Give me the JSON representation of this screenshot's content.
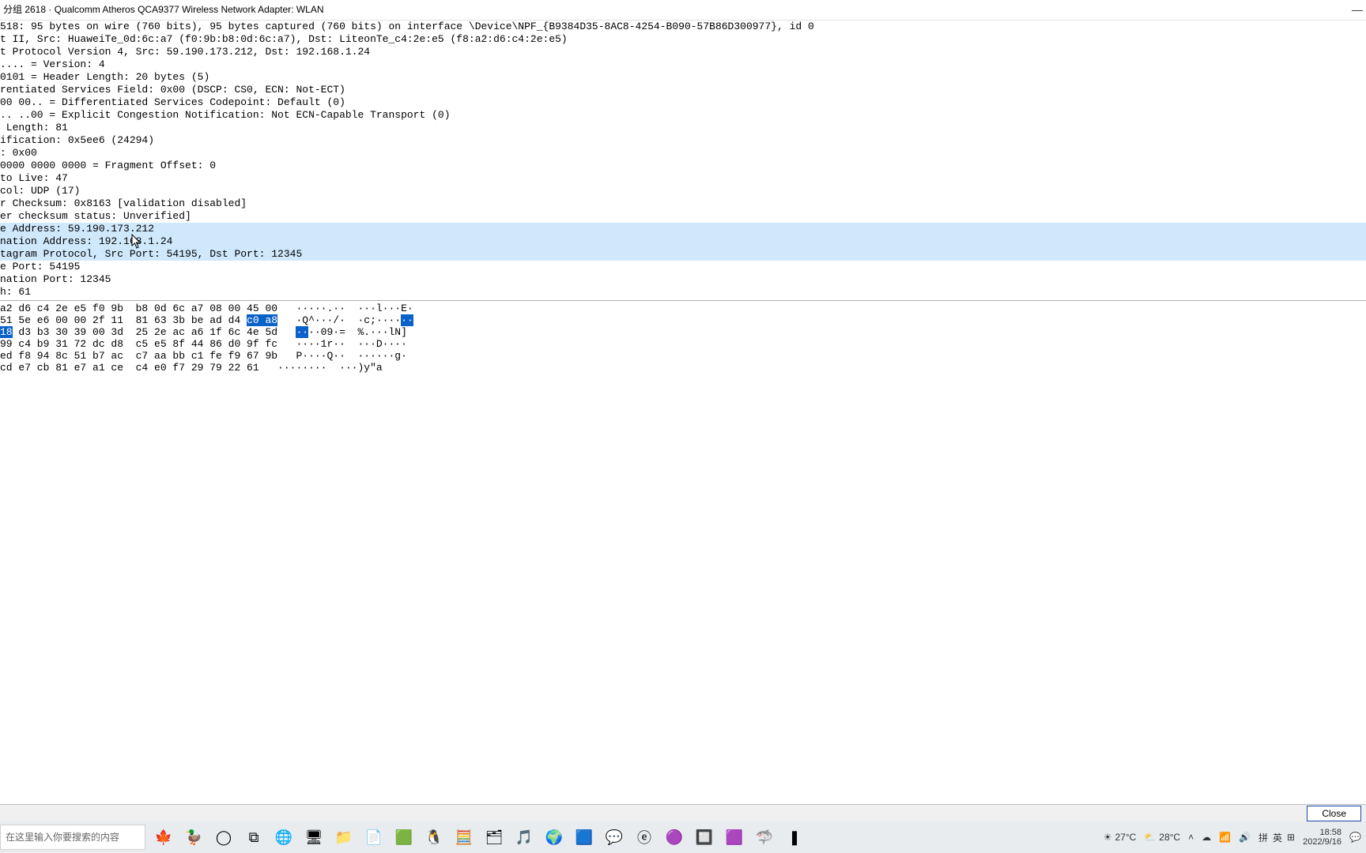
{
  "title": "分组 2618 · Qualcomm Atheros QCA9377 Wireless Network Adapter: WLAN",
  "details": [
    {
      "text": "518: 95 bytes on wire (760 bits), 95 bytes captured (760 bits) on interface \\Device\\NPF_{B9384D35-8AC8-4254-B090-57B86D300977}, id 0",
      "sel": false
    },
    {
      "text": "t II, Src: HuaweiTe_0d:6c:a7 (f0:9b:b8:0d:6c:a7), Dst: LiteonTe_c4:2e:e5 (f8:a2:d6:c4:2e:e5)",
      "sel": false
    },
    {
      "text": "t Protocol Version 4, Src: 59.190.173.212, Dst: 192.168.1.24",
      "sel": false
    },
    {
      "text": ".... = Version: 4",
      "sel": false
    },
    {
      "text": "0101 = Header Length: 20 bytes (5)",
      "sel": false
    },
    {
      "text": "rentiated Services Field: 0x00 (DSCP: CS0, ECN: Not-ECT)",
      "sel": false
    },
    {
      "text": "00 00.. = Differentiated Services Codepoint: Default (0)",
      "sel": false
    },
    {
      "text": ".. ..00 = Explicit Congestion Notification: Not ECN-Capable Transport (0)",
      "sel": false
    },
    {
      "text": " Length: 81",
      "sel": false
    },
    {
      "text": "ification: 0x5ee6 (24294)",
      "sel": false
    },
    {
      "text": ": 0x00",
      "sel": false
    },
    {
      "text": "0000 0000 0000 = Fragment Offset: 0",
      "sel": false
    },
    {
      "text": "to Live: 47",
      "sel": false
    },
    {
      "text": "col: UDP (17)",
      "sel": false
    },
    {
      "text": "r Checksum: 0x8163 [validation disabled]",
      "sel": false
    },
    {
      "text": "er checksum status: Unverified]",
      "sel": false
    },
    {
      "text": "e Address: 59.190.173.212",
      "sel": true
    },
    {
      "text": "nation Address: 192.168.1.24",
      "sel": true
    },
    {
      "text": "tagram Protocol, Src Port: 54195, Dst Port: 12345",
      "sel": true
    },
    {
      "text": "e Port: 54195",
      "sel": false
    },
    {
      "text": "nation Port: 12345",
      "sel": false
    },
    {
      "text": "h: 61",
      "sel": false
    }
  ],
  "hex": {
    "rows": [
      {
        "pre": "a2 d6 c4 2e e5 f0 9b  b8 0d 6c a7 08 00 45 00",
        "asc": "   ·····.··  ···l···E·",
        "hl": []
      },
      {
        "pre": "51 5e e6 00 00 2f 11  81 63 3b be ad d4 ",
        "mid": "c0 a8",
        "asc": "   ·Q^···/·  ·c;····",
        "asc_hl": "··",
        "hl": [
          true
        ]
      },
      {
        "pre2": "18",
        "mid2": " d3 b3 30 39 00 3d  25 2e ac a6 1f 6c 4e 5d",
        "asc_pre": "   ",
        "asc_hl2": "··",
        "asc_post": "··09·=  %.···lN]",
        "hl2": true
      },
      {
        "pre": "99 c4 b9 31 72 dc d8  c5 e5 8f 44 86 d0 9f fc",
        "asc": "   ····1r··  ···D····",
        "hl": []
      },
      {
        "pre": "ed f8 94 8c 51 b7 ac  c7 aa bb c1 fe f9 67 9b",
        "asc": "   P····Q··  ······g·",
        "hl": []
      },
      {
        "pre": "cd e7 cb 81 e7 a1 ce  c4 e0 f7 29 79 22 61",
        "asc": "   ········  ···)y\"a",
        "hl": []
      }
    ]
  },
  "close_label": "Close",
  "taskbar": {
    "search_placeholder": "在这里输入你要搜索的内容",
    "icons": [
      "leaf",
      "goose",
      "cortana",
      "taskview",
      "globe",
      "monitor",
      "folder",
      "notepad",
      "todo",
      "qq",
      "calc",
      "filemgr",
      "music",
      "browser",
      "edge",
      "wechat",
      "ie",
      "eclipse",
      "screen",
      "vscode",
      "wireshark",
      "terminal"
    ],
    "weather1": {
      "temp": "27°C",
      "label": ""
    },
    "weather2": {
      "temp": "28°C",
      "label": ""
    },
    "ime": {
      "pinyin": "拼",
      "lang": "英",
      "grid": "⊞"
    },
    "clock": {
      "time": "18:58",
      "date": "2022/9/16"
    }
  }
}
